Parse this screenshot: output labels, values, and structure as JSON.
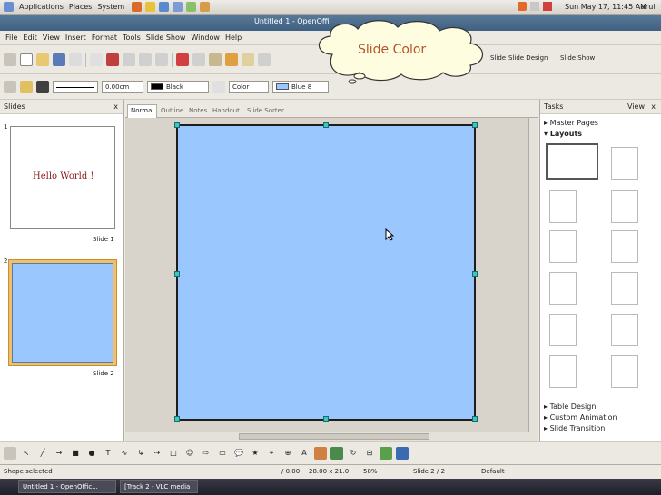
{
  "panel": {
    "menus": [
      "Applications",
      "Places",
      "System"
    ],
    "clock": "Sun May 17, 11:45 AM",
    "user": "arul"
  },
  "window": {
    "title": "Untitled 1 - OpenOffi"
  },
  "menubar": [
    "File",
    "Edit",
    "View",
    "Insert",
    "Format",
    "Tools",
    "Slide Show",
    "Window",
    "Help"
  ],
  "toolbar1": {
    "slide_label": "Slide",
    "slide_design": "Slide Design",
    "slide_show": "Slide Show"
  },
  "toolbar2": {
    "line_width": "0.00cm",
    "line_color": "Black",
    "area_style": "Color",
    "area_color": "Blue 8",
    "colors": {
      "line": "#000000",
      "area": "#99c7fe"
    }
  },
  "callout": {
    "text": "Slide Color"
  },
  "slides_pane": {
    "title": "Slides",
    "close": "x",
    "items": [
      {
        "number": "1",
        "label": "Slide 1",
        "text": "Hello World !"
      },
      {
        "number": "2",
        "label": "Slide 2"
      }
    ]
  },
  "tabs": [
    "Normal",
    "Outline",
    "Notes",
    "Handout",
    "Slide Sorter"
  ],
  "slide": {
    "background": "#99c7fe"
  },
  "tasks": {
    "title": "Tasks",
    "view": "View",
    "close": "x",
    "sections": {
      "master_pages": "Master Pages",
      "layouts": "Layouts",
      "table_design": "Table Design",
      "custom_animation": "Custom Animation",
      "slide_transition": "Slide Transition"
    }
  },
  "statusbar": {
    "status": "Shape selected",
    "position": "/ 0.00",
    "size": "28.00 x 21.0",
    "zoom": "58%",
    "page": "Slide 2 / 2",
    "style": "Default"
  },
  "taskbar": {
    "items": [
      "Untitled 1 - OpenOffic...",
      "[Track 2 - VLC media ..."
    ]
  }
}
